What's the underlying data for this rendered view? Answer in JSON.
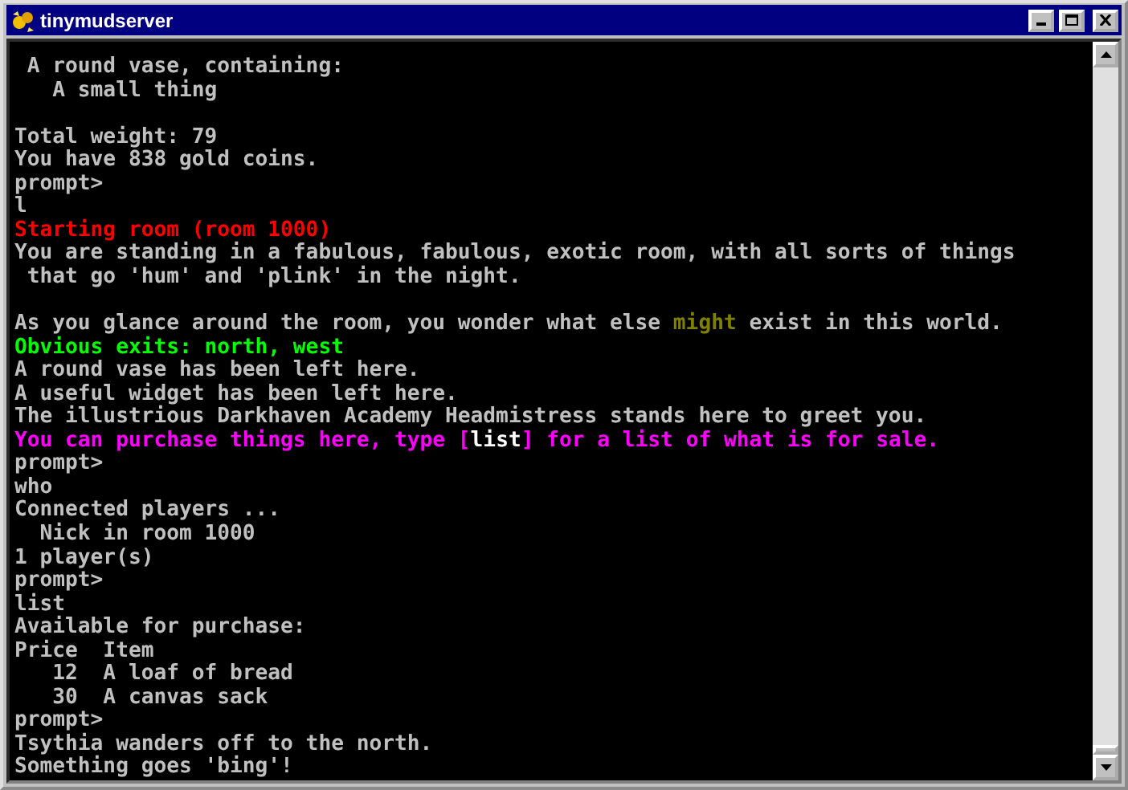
{
  "window": {
    "title": "tinymudserver"
  },
  "terminal": {
    "lines": [
      {
        "kind": "text",
        "segments": [
          {
            "text": " A round vase, containing:",
            "color": "#c0c0c0"
          }
        ]
      },
      {
        "kind": "text",
        "segments": [
          {
            "text": "   A small thing",
            "color": "#c0c0c0"
          }
        ]
      },
      {
        "kind": "blank"
      },
      {
        "kind": "text",
        "segments": [
          {
            "text": "Total weight: 79",
            "color": "#c0c0c0"
          }
        ]
      },
      {
        "kind": "text",
        "segments": [
          {
            "text": "You have 838 gold coins.",
            "color": "#c0c0c0"
          }
        ]
      },
      {
        "kind": "text",
        "segments": [
          {
            "text": "prompt>",
            "color": "#c0c0c0"
          }
        ]
      },
      {
        "kind": "text",
        "segments": [
          {
            "text": "l",
            "color": "#c0c0c0"
          }
        ]
      },
      {
        "kind": "text",
        "segments": [
          {
            "text": "Starting room (room 1000)",
            "color": "#ff0000"
          }
        ]
      },
      {
        "kind": "text",
        "segments": [
          {
            "text": "You are standing in a fabulous, fabulous, exotic room, with all sorts of things",
            "color": "#c0c0c0"
          }
        ]
      },
      {
        "kind": "text",
        "segments": [
          {
            "text": " that go 'hum' and 'plink' in the night.",
            "color": "#c0c0c0"
          }
        ]
      },
      {
        "kind": "blank"
      },
      {
        "kind": "text",
        "segments": [
          {
            "text": "As you glance around the room, you wonder what else ",
            "color": "#c0c0c0"
          },
          {
            "text": "might",
            "color": "#808000"
          },
          {
            "text": " exist in this world.",
            "color": "#c0c0c0"
          }
        ]
      },
      {
        "kind": "text",
        "segments": [
          {
            "text": "Obvious exits: north, west",
            "color": "#00ff00"
          }
        ]
      },
      {
        "kind": "text",
        "segments": [
          {
            "text": "A round vase has been left here.",
            "color": "#c0c0c0"
          }
        ]
      },
      {
        "kind": "text",
        "segments": [
          {
            "text": "A useful widget has been left here.",
            "color": "#c0c0c0"
          }
        ]
      },
      {
        "kind": "text",
        "segments": [
          {
            "text": "The illustrious Darkhaven Academy Headmistress stands here to greet you.",
            "color": "#c0c0c0"
          }
        ]
      },
      {
        "kind": "text",
        "segments": [
          {
            "text": "You can purchase things here, type [",
            "color": "#ff00ff"
          },
          {
            "text": "list",
            "color": "#ffffff"
          },
          {
            "text": "] for a list of what is for sale.",
            "color": "#ff00ff"
          }
        ]
      },
      {
        "kind": "text",
        "segments": [
          {
            "text": "prompt>",
            "color": "#c0c0c0"
          }
        ]
      },
      {
        "kind": "text",
        "segments": [
          {
            "text": "who",
            "color": "#c0c0c0"
          }
        ]
      },
      {
        "kind": "text",
        "segments": [
          {
            "text": "Connected players ...",
            "color": "#c0c0c0"
          }
        ]
      },
      {
        "kind": "text",
        "segments": [
          {
            "text": "  Nick in room 1000",
            "color": "#c0c0c0"
          }
        ]
      },
      {
        "kind": "text",
        "segments": [
          {
            "text": "1 player(s)",
            "color": "#c0c0c0"
          }
        ]
      },
      {
        "kind": "text",
        "segments": [
          {
            "text": "prompt>",
            "color": "#c0c0c0"
          }
        ]
      },
      {
        "kind": "text",
        "segments": [
          {
            "text": "list",
            "color": "#c0c0c0"
          }
        ]
      },
      {
        "kind": "text",
        "segments": [
          {
            "text": "Available for purchase:",
            "color": "#c0c0c0"
          }
        ]
      },
      {
        "kind": "text",
        "segments": [
          {
            "text": "Price  Item",
            "color": "#c0c0c0"
          }
        ]
      },
      {
        "kind": "text",
        "segments": [
          {
            "text": "   12  A loaf of bread",
            "color": "#c0c0c0"
          }
        ]
      },
      {
        "kind": "text",
        "segments": [
          {
            "text": "   30  A canvas sack",
            "color": "#c0c0c0"
          }
        ]
      },
      {
        "kind": "text",
        "segments": [
          {
            "text": "prompt>",
            "color": "#c0c0c0"
          }
        ]
      },
      {
        "kind": "text",
        "segments": [
          {
            "text": "Tsythia wanders off to the north.",
            "color": "#c0c0c0"
          }
        ]
      },
      {
        "kind": "text",
        "segments": [
          {
            "text": "Something goes 'bing'!",
            "color": "#c0c0c0"
          }
        ]
      }
    ]
  }
}
